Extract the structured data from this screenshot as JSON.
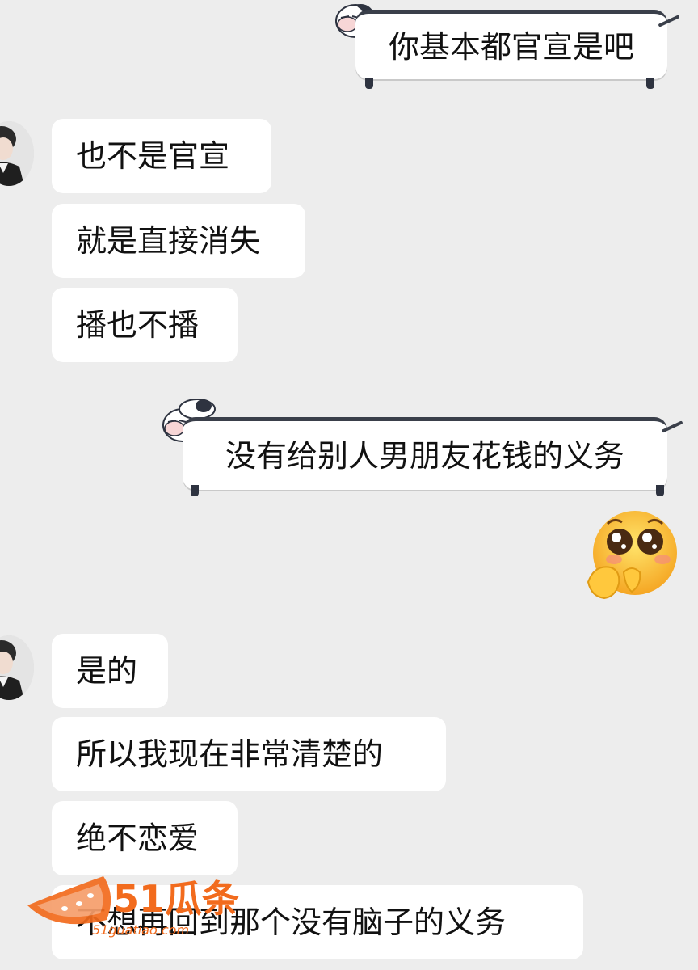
{
  "messages": {
    "m1": "你基本都官宣是吧",
    "m2": "也不是官宣",
    "m3": "就是直接消失",
    "m4": "播也不播",
    "m5": "没有给别人男朋友花钱的义务",
    "m6": "是的",
    "m7": "所以我现在非常清楚的",
    "m8": "绝不恋爱",
    "m9": "不想再回到那个没有脑子的义务"
  },
  "sticker": {
    "icon": "pleading-face-emoji"
  },
  "watermark": {
    "brand": "51瓜条",
    "url": "51guatiao.com"
  },
  "colors": {
    "background": "#ededed",
    "bubble": "#ffffff",
    "watermark": "#f26b1d"
  }
}
